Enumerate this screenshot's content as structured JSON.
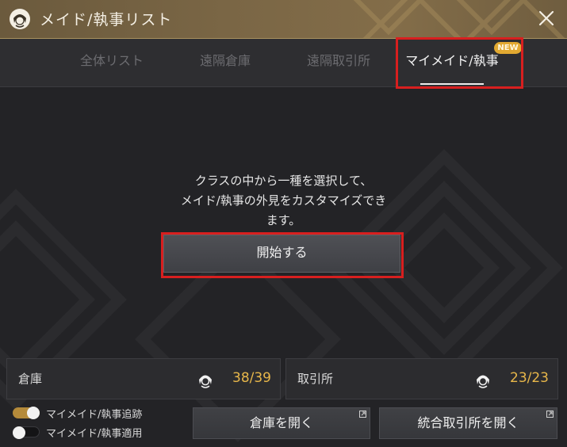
{
  "window": {
    "title": "メイド/執事リスト",
    "accent": "#7a6645",
    "icons": {
      "title": "maid-icon",
      "close": "close-icon"
    }
  },
  "tabs": [
    {
      "label": "全体リスト",
      "active": false
    },
    {
      "label": "遠隔倉庫",
      "active": false
    },
    {
      "label": "遠隔取引所",
      "active": false
    },
    {
      "label": "マイメイド/執事",
      "active": true,
      "badge": "NEW"
    }
  ],
  "main": {
    "description_lines": [
      "クラスの中から一種を選択して、",
      "メイド/執事の外見をカスタマイズでき",
      "ます。"
    ],
    "start_button": "開始する",
    "highlight_color": "#d81f1f"
  },
  "storage": {
    "warehouse": {
      "label": "倉庫",
      "count": "38/39",
      "icon": "maid-icon"
    },
    "market": {
      "label": "取引所",
      "count": "23/23",
      "icon": "maid-icon"
    }
  },
  "toggles": [
    {
      "label": "マイメイド/執事追跡",
      "on": true
    },
    {
      "label": "マイメイド/執事適用",
      "on": false
    }
  ],
  "buttons": {
    "open_warehouse": "倉庫を開く",
    "open_market": "統合取引所を開く"
  },
  "colors": {
    "count": "#e8b74a",
    "badge": "#e2a931",
    "toggle_on": "#b48a3a"
  }
}
